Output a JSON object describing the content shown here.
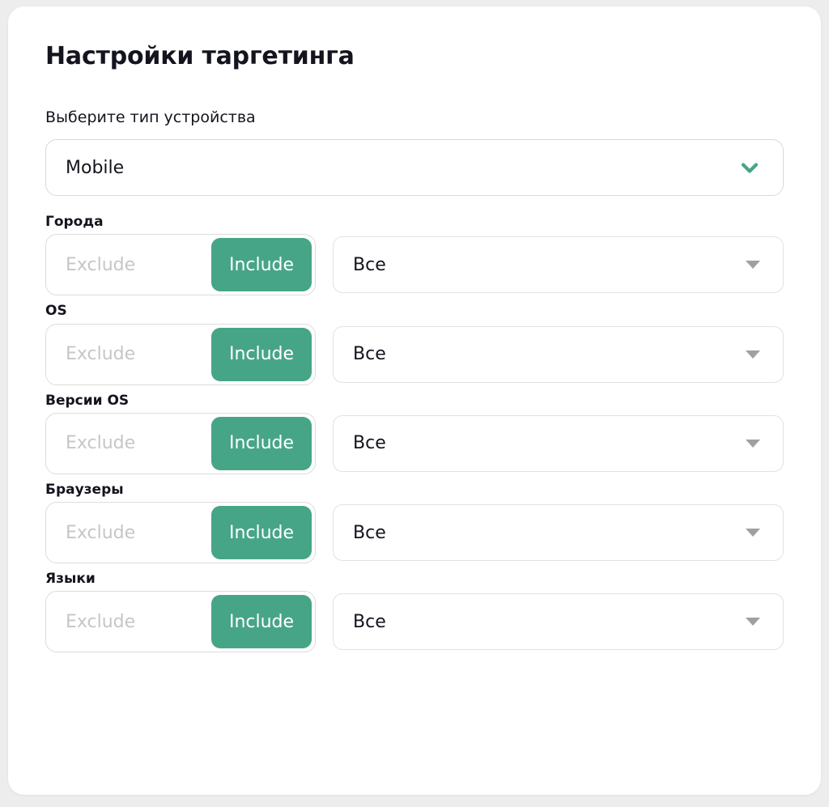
{
  "page": {
    "title": "Настройки таргетинга",
    "background_color": "#ededed",
    "card_color": "#ffffff"
  },
  "device": {
    "label": "Выберите тип устройства",
    "selected": "Mobile",
    "chevron_icon": "chevron-down-icon",
    "chevron_color": "#47a587"
  },
  "toggle": {
    "exclude_label": "Exclude",
    "include_label": "Include",
    "active": "Include",
    "active_color": "#47a587",
    "inactive_text_color": "#c6c6c6"
  },
  "select_caret": {
    "icon": "caret-down-icon",
    "color": "#a0a0a0"
  },
  "filters": [
    {
      "label": "Города",
      "exclude_label": "Exclude",
      "include_label": "Include",
      "value": "Все"
    },
    {
      "label": "OS",
      "exclude_label": "Exclude",
      "include_label": "Include",
      "value": "Все"
    },
    {
      "label": "Версии OS",
      "exclude_label": "Exclude",
      "include_label": "Include",
      "value": "Все"
    },
    {
      "label": "Браузеры",
      "exclude_label": "Exclude",
      "include_label": "Include",
      "value": "Все"
    },
    {
      "label": "Языки",
      "exclude_label": "Exclude",
      "include_label": "Include",
      "value": "Все"
    }
  ]
}
